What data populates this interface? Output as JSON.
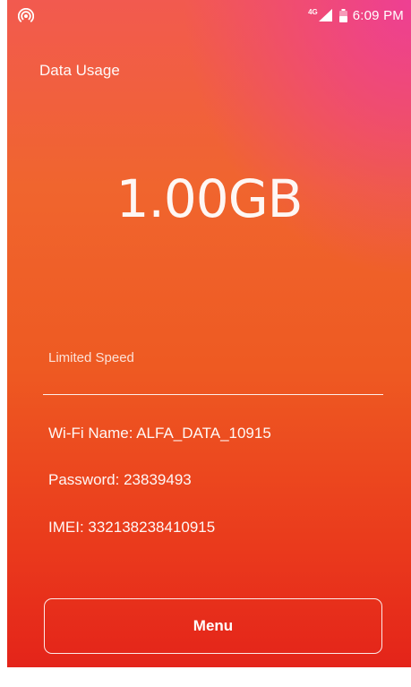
{
  "statusbar": {
    "hotspot_icon": "hotspot-icon",
    "network_type": "4G",
    "signal_icon": "signal-icon",
    "battery_icon": "battery-icon",
    "time": "6:09 PM"
  },
  "screen": {
    "title": "Data Usage",
    "usage_value": "1.00GB",
    "speed_status": "Limited Speed",
    "wifi_name": "Wi-Fi Name: ALFA_DATA_10915",
    "password": "Password: 23839493",
    "imei": "IMEI: 332138238410915",
    "menu_label": "Menu"
  },
  "colors": {
    "gradient_top_right": "#ee3f93",
    "gradient_middle": "#f0652e",
    "gradient_bottom": "#e4241a",
    "text": "#ffffff"
  }
}
